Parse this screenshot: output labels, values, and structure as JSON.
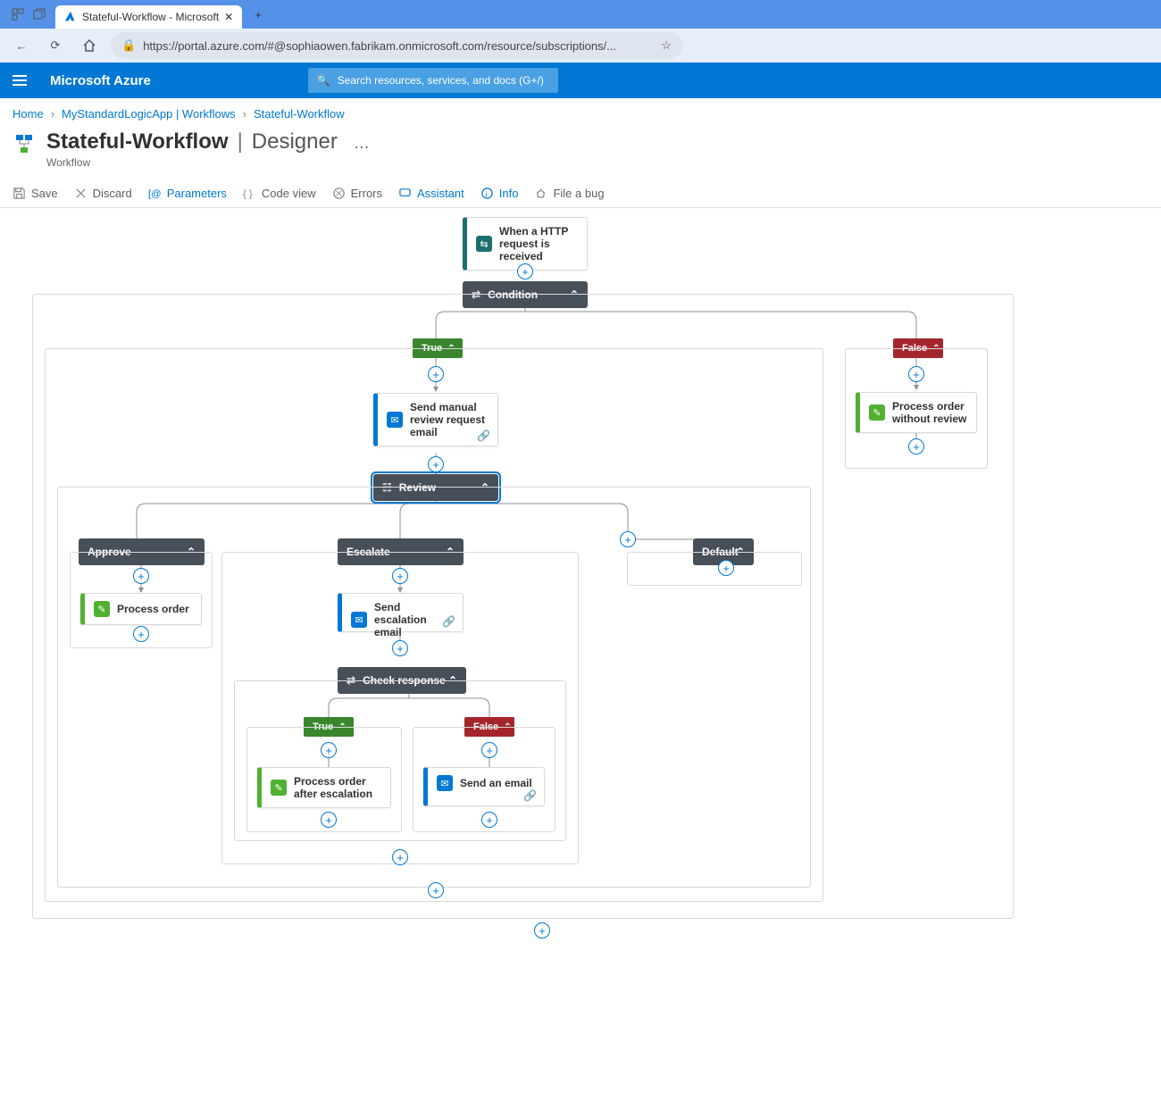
{
  "browser": {
    "tab_title": "Stateful-Workflow - Microsoft",
    "url": "https://portal.azure.com/#@sophiaowen.fabrikam.onmicrosoft.com/resource/subscriptions/..."
  },
  "azure": {
    "brand": "Microsoft Azure",
    "search_placeholder": "Search resources, services, and docs (G+/)"
  },
  "breadcrumb": {
    "home": "Home",
    "item1": "MyStandardLogicApp | Workflows",
    "item2": "Stateful-Workflow"
  },
  "page": {
    "title": "Stateful-Workflow",
    "section": "Designer",
    "subtype": "Workflow"
  },
  "toolbar": {
    "save": "Save",
    "discard": "Discard",
    "parameters": "Parameters",
    "codeview": "Code view",
    "errors": "Errors",
    "assistant": "Assistant",
    "info": "Info",
    "filebug": "File a bug"
  },
  "nodes": {
    "trigger": "When a HTTP request is received",
    "condition": "Condition",
    "true": "True",
    "false": "False",
    "send_review": "Send manual review request email",
    "process_no_review": "Process order without review",
    "review": "Review",
    "approve": "Approve",
    "escalate": "Escalate",
    "default": "Default",
    "process_order": "Process order",
    "send_escalation": "Send escalation email",
    "check_response": "Check response",
    "process_after_escalation": "Process order after escalation",
    "send_an_email": "Send an email"
  }
}
